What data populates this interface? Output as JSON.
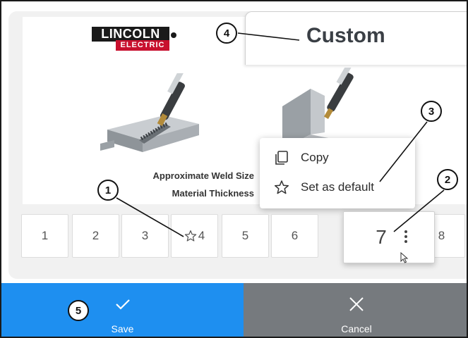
{
  "header": {
    "logo_top": "LINCOLN",
    "logo_bottom": "ELECTRIC",
    "custom_title": "Custom"
  },
  "illustration": {
    "weld_size_label": "Approximate Weld Size",
    "thickness_label": "Material Thickness"
  },
  "context_menu": {
    "items": [
      {
        "label": "Copy",
        "icon": "copy-icon"
      },
      {
        "label": "Set as default",
        "icon": "star-outline-icon"
      }
    ]
  },
  "tabs": [
    {
      "label": "1"
    },
    {
      "label": "2"
    },
    {
      "label": "3"
    },
    {
      "label": "4",
      "favorite": true
    },
    {
      "label": "5"
    },
    {
      "label": "6"
    },
    {
      "label": "7",
      "selected": true
    },
    {
      "label": "8"
    }
  ],
  "actions": {
    "save_label": "Save",
    "cancel_label": "Cancel"
  },
  "callouts": [
    "1",
    "2",
    "3",
    "4",
    "5"
  ],
  "colors": {
    "save": "#1e8ff0",
    "cancel": "#767a7e",
    "lincoln_red": "#c8102e"
  }
}
